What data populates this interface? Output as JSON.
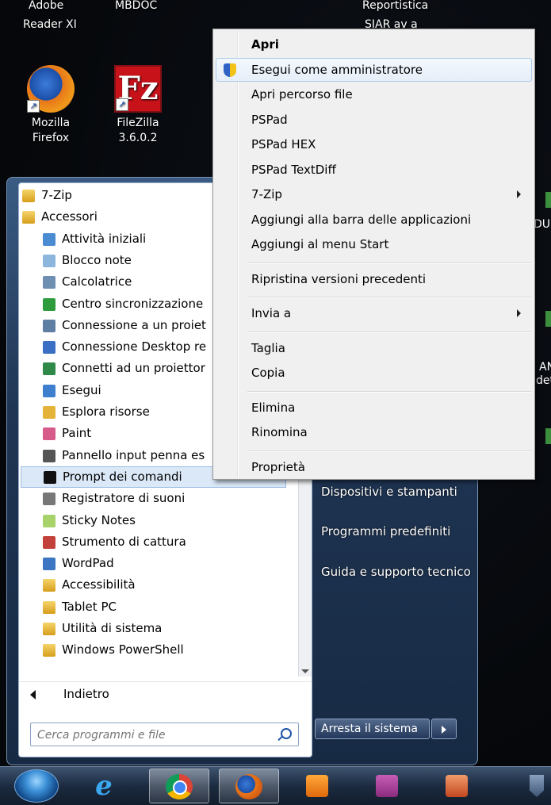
{
  "desktop": {
    "top_labels": [
      "Adobe",
      "MBDOC",
      "Reportistica"
    ],
    "top_labels2": [
      "Reader XI",
      "SIAR av a"
    ],
    "icons": [
      {
        "line1": "Mozilla",
        "line2": "Firefox",
        "icon": "firefox-icon"
      },
      {
        "line1": "FileZilla",
        "line2": "3.6.0.2",
        "icon": "filezilla-icon"
      }
    ],
    "fz_letter": "Fz",
    "right_fragments": [
      "DU",
      "AN",
      "det"
    ]
  },
  "start_menu": {
    "programs": [
      {
        "label": "7-Zip",
        "type": "folder",
        "icon": "folder-icon",
        "indent": 0
      },
      {
        "label": "Accessori",
        "type": "folder",
        "icon": "folder-icon",
        "indent": 0
      },
      {
        "label": "Attività iniziali",
        "type": "app",
        "icon": "getting-started-icon",
        "color": "#4a8bd1",
        "indent": 1
      },
      {
        "label": "Blocco note",
        "type": "app",
        "icon": "notepad-icon",
        "color": "#8cb6dd",
        "indent": 1
      },
      {
        "label": "Calcolatrice",
        "type": "app",
        "icon": "calculator-icon",
        "color": "#6f8fb2",
        "indent": 1
      },
      {
        "label": "Centro sincronizzazione",
        "type": "app",
        "icon": "sync-center-icon",
        "color": "#2e9b3c",
        "indent": 1
      },
      {
        "label": "Connessione a un proiet",
        "type": "app",
        "icon": "projector-connection-icon",
        "color": "#5f7ea3",
        "indent": 1
      },
      {
        "label": "Connessione Desktop re",
        "type": "app",
        "icon": "remote-desktop-icon",
        "color": "#3a6fc4",
        "indent": 1
      },
      {
        "label": "Connetti ad un proiettor",
        "type": "app",
        "icon": "connect-projector-icon",
        "color": "#2f8a4a",
        "indent": 1
      },
      {
        "label": "Esegui",
        "type": "app",
        "icon": "run-icon",
        "color": "#3f7fd0",
        "indent": 1
      },
      {
        "label": "Esplora risorse",
        "type": "app",
        "icon": "explorer-icon",
        "color": "#e4b43a",
        "indent": 1
      },
      {
        "label": "Paint",
        "type": "app",
        "icon": "paint-icon",
        "color": "#d65a8a",
        "indent": 1
      },
      {
        "label": "Pannello input penna es",
        "type": "app",
        "icon": "pen-input-icon",
        "color": "#555555",
        "indent": 1
      },
      {
        "label": "Prompt dei comandi",
        "type": "app",
        "icon": "cmd-icon",
        "color": "#111111",
        "indent": 1,
        "selected": true
      },
      {
        "label": "Registratore di suoni",
        "type": "app",
        "icon": "sound-recorder-icon",
        "color": "#777777",
        "indent": 1
      },
      {
        "label": "Sticky Notes",
        "type": "app",
        "icon": "sticky-notes-icon",
        "color": "#a8d36b",
        "indent": 1
      },
      {
        "label": "Strumento di cattura",
        "type": "app",
        "icon": "snipping-tool-icon",
        "color": "#c2413a",
        "indent": 1
      },
      {
        "label": "WordPad",
        "type": "app",
        "icon": "wordpad-icon",
        "color": "#3c76c2",
        "indent": 1
      },
      {
        "label": "Accessibilità",
        "type": "folder",
        "icon": "folder-icon",
        "indent": 1
      },
      {
        "label": "Tablet PC",
        "type": "folder",
        "icon": "folder-icon",
        "indent": 1
      },
      {
        "label": "Utilità di sistema",
        "type": "folder",
        "icon": "folder-icon",
        "indent": 1
      },
      {
        "label": "Windows PowerShell",
        "type": "folder",
        "icon": "folder-icon",
        "indent": 1
      }
    ],
    "back_label": "Indietro",
    "search_placeholder": "Cerca programmi e file",
    "right_links": [
      "Dispositivi e stampanti",
      "Programmi predefiniti",
      "Guida e supporto tecnico"
    ],
    "shutdown_label": "Arresta il sistema"
  },
  "context_menu": {
    "items": [
      {
        "label": "Apri",
        "bold": true
      },
      {
        "label": "Esegui come amministratore",
        "icon": "uac-shield-icon",
        "highlighted": true
      },
      {
        "label": "Apri percorso file"
      },
      {
        "label": "PSPad"
      },
      {
        "label": "PSPad HEX"
      },
      {
        "label": "PSPad TextDiff"
      },
      {
        "label": "7-Zip",
        "submenu": true
      },
      {
        "label": "Aggiungi alla barra delle applicazioni"
      },
      {
        "label": "Aggiungi al menu Start"
      },
      {
        "separator": true
      },
      {
        "label": "Ripristina versioni precedenti"
      },
      {
        "separator": true
      },
      {
        "label": "Invia a",
        "submenu": true
      },
      {
        "separator": true
      },
      {
        "label": "Taglia"
      },
      {
        "label": "Copia"
      },
      {
        "separator": true
      },
      {
        "label": "Elimina"
      },
      {
        "label": "Rinomina"
      },
      {
        "separator": true
      },
      {
        "label": "Proprietà"
      }
    ]
  },
  "taskbar": {
    "buttons": [
      {
        "icon": "internet-explorer-icon",
        "active": false
      },
      {
        "icon": "chrome-icon",
        "active": true
      },
      {
        "icon": "firefox-icon",
        "active": true
      },
      {
        "icon": "media-player-icon",
        "active": false
      },
      {
        "icon": "keepass-icon",
        "active": false
      },
      {
        "icon": "powerpoint-icon",
        "active": false
      }
    ],
    "ie_glyph": "e"
  }
}
